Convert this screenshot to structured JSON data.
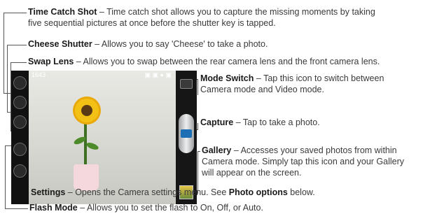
{
  "callouts": [
    {
      "name": "Time Catch Shot",
      "desc": " – Time catch shot allows you to capture the missing moments by taking",
      "desc2": "five sequential pictures at once before the shutter key is tapped."
    },
    {
      "name": "Cheese Shutter",
      "desc": " – Allows you to say 'Cheese' to take a photo."
    },
    {
      "name": "Swap Lens",
      "desc": " – Allows you to swap between the rear camera lens and the front camera lens."
    },
    {
      "name": "Mode Switch",
      "desc": " – Tap this icon to switch between",
      "desc2": "Camera mode and Video mode."
    },
    {
      "name": "Capture",
      "desc": " – Tap to take a photo."
    },
    {
      "name": "Gallery",
      "desc": " – Accesses your saved photos from within",
      "desc2": "Camera mode. Simply tap this icon and your Gallery",
      "desc3": "will appear on the screen."
    },
    {
      "name": "Settings",
      "desc": " – Opens the Camera settings menu. See ",
      "link": "Photo options",
      "desc_end": " below."
    },
    {
      "name": "Flash Mode",
      "desc": " – Allows you to set the flash to On, Off, or Auto."
    }
  ],
  "screen": {
    "shot_count": "1643"
  },
  "icons": {
    "time_catch": "time-catch-icon",
    "cheese": "cheese-shutter-icon",
    "swap": "swap-lens-icon",
    "flash": "flash-icon",
    "settings": "gear-icon",
    "mode": "camera-mode-icon",
    "capture": "camera-icon",
    "gallery": "gallery-thumbnail-icon"
  }
}
